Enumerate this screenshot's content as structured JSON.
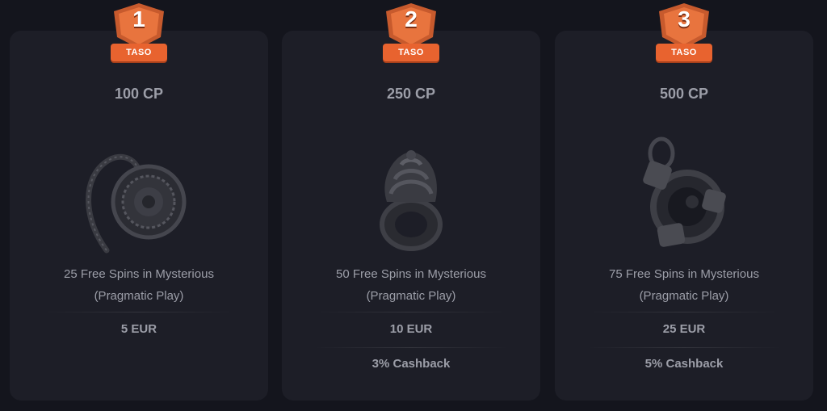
{
  "badge": {
    "label": "TASO",
    "color": "#e8632f"
  },
  "colors": {
    "background": "#14151d",
    "card": "#1d1e27",
    "text": "#9c9ea8"
  },
  "tiers": [
    {
      "number": "1",
      "points": "100 CP",
      "icon": "medallion-pendant-icon",
      "description_line1": "25 Free Spins in Mysterious",
      "description_line2": "(Pragmatic Play)",
      "reward_cash": "5 EUR",
      "reward_cashback": ""
    },
    {
      "number": "2",
      "points": "250 CP",
      "icon": "spiral-ring-icon",
      "description_line1": "50 Free Spins in Mysterious",
      "description_line2": "(Pragmatic Play)",
      "reward_cash": "10 EUR",
      "reward_cashback": "3% Cashback"
    },
    {
      "number": "3",
      "points": "500 CP",
      "icon": "gem-pendant-icon",
      "description_line1": "75 Free Spins in Mysterious",
      "description_line2": "(Pragmatic Play)",
      "reward_cash": "25 EUR",
      "reward_cashback": "5% Cashback"
    }
  ]
}
